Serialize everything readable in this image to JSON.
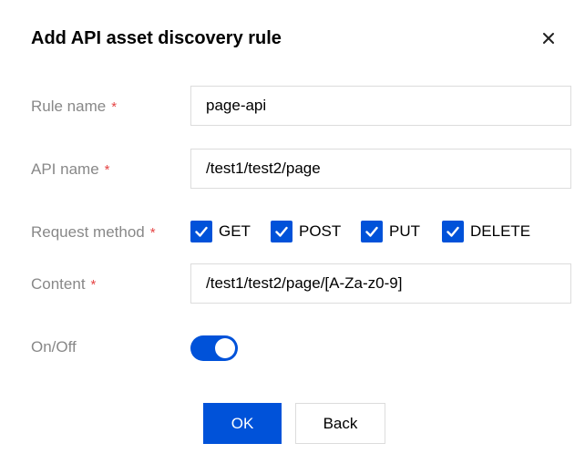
{
  "dialog": {
    "title": "Add API asset discovery rule",
    "close_icon": "close-icon"
  },
  "form": {
    "rule_name": {
      "label": "Rule name",
      "required_mark": "*",
      "value": "page-api"
    },
    "api_name": {
      "label": "API name",
      "required_mark": "*",
      "value": "/test1/test2/page"
    },
    "request_method": {
      "label": "Request method",
      "required_mark": "*",
      "options": [
        {
          "label": "GET",
          "checked": true
        },
        {
          "label": "POST",
          "checked": true
        },
        {
          "label": "PUT",
          "checked": true
        },
        {
          "label": "DELETE",
          "checked": true
        }
      ]
    },
    "content": {
      "label": "Content",
      "required_mark": "*",
      "value": "/test1/test2/page/[A-Za-z0-9]"
    },
    "on_off": {
      "label": "On/Off",
      "enabled": true
    }
  },
  "buttons": {
    "ok": "OK",
    "back": "Back"
  },
  "colors": {
    "accent": "#0052d9",
    "required": "#e54545",
    "label": "#888888",
    "border": "#dcdcdc"
  }
}
